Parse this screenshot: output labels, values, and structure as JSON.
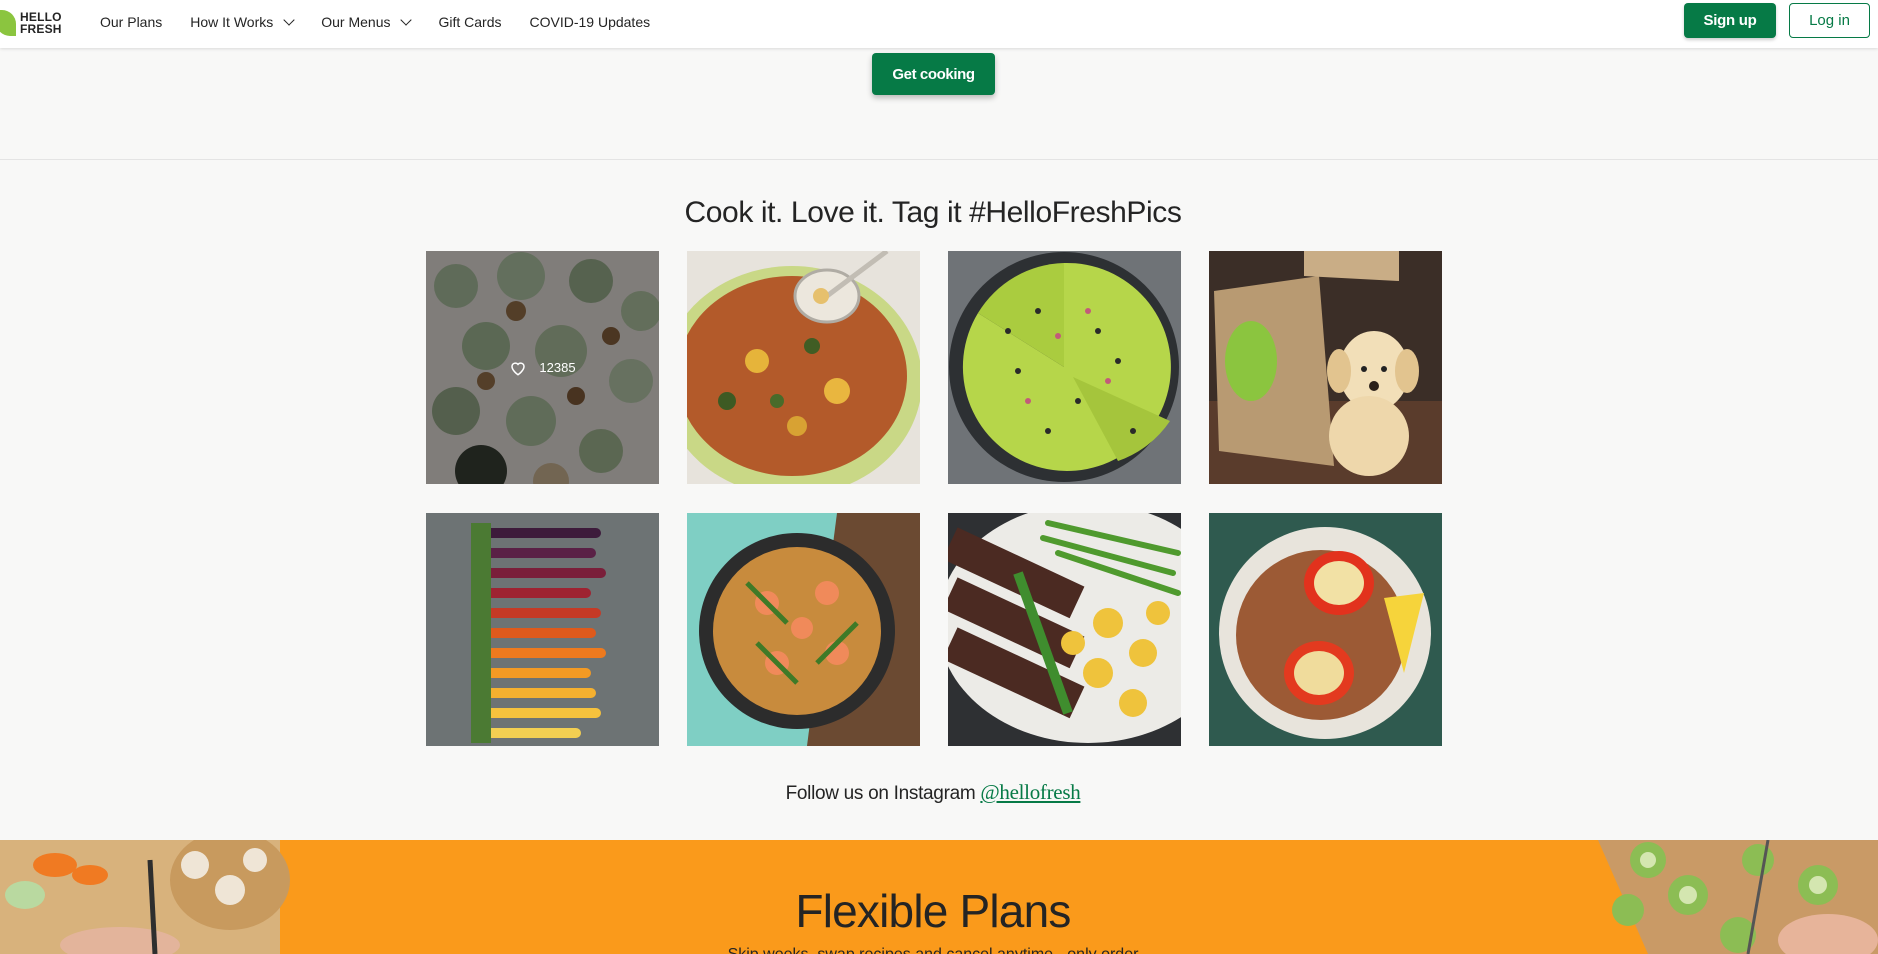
{
  "header": {
    "logo_line1": "HELLO",
    "logo_line2": "FRESH",
    "nav": [
      "Our Plans",
      "How It Works",
      "Our Menus",
      "Gift Cards",
      "COVID-19 Updates"
    ],
    "signup": "Sign up",
    "login": "Log in"
  },
  "hero": {
    "cta": "Get cooking"
  },
  "gallery": {
    "title": "Cook it. Love it. Tag it #HelloFreshPics",
    "hover_likes": "12385",
    "tiles": [
      {
        "name": "photo-cupcakes",
        "subject": "cupcakes"
      },
      {
        "name": "photo-soup-pot",
        "subject": "soup pot"
      },
      {
        "name": "photo-avocado-pizza",
        "subject": "avocado pizza"
      },
      {
        "name": "photo-puppy-box",
        "subject": "puppy with box"
      },
      {
        "name": "photo-carrots",
        "subject": "rainbow carrots"
      },
      {
        "name": "photo-shrimp-noodles",
        "subject": "shrimp noodles"
      },
      {
        "name": "photo-steak-potatoes",
        "subject": "steak and potatoes"
      },
      {
        "name": "photo-stuffed-peppers",
        "subject": "stuffed peppers"
      }
    ],
    "follow_text": "Follow us on Instagram ",
    "follow_handle": "@hellofresh"
  },
  "plans": {
    "title": "Flexible Plans",
    "subtitle": "Skip weeks, swap recipes and cancel anytime - only order"
  },
  "colors": {
    "brand_green": "#067a46",
    "leaf_green": "#8bc53f",
    "orange": "#fa9a1b"
  }
}
